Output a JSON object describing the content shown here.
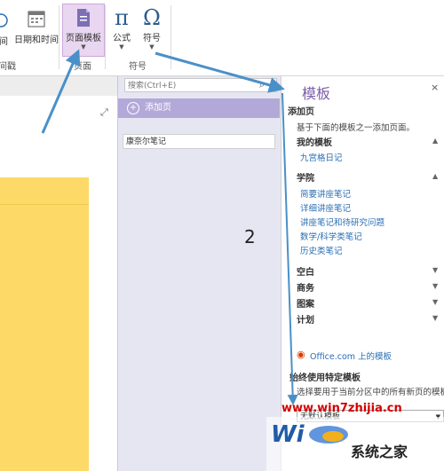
{
  "ribbon": {
    "left_button_label": "间",
    "datetime_label": "日期和时间",
    "page_template_label": "页面模板",
    "formula_label": "公式",
    "symbol_label": "符号",
    "group_timestamp": "间戳",
    "group_page": "页面",
    "group_symbols": "符号"
  },
  "search": {
    "placeholder": "搜索(Ctrl+E)"
  },
  "pages": {
    "add_label": "添加页",
    "items": [
      "康奈尔笔记"
    ]
  },
  "pane": {
    "title": "模板",
    "add_page_heading": "添加页",
    "add_page_desc": "基于下面的模板之一添加页面。",
    "my_templates": "我的模板",
    "my_items": [
      "九宫格日记"
    ],
    "academic": "学院",
    "academic_items": [
      "简要讲座笔记",
      "详细讲座笔记",
      "讲座笔记和待研究问题",
      "数学/科学类笔记",
      "历史类笔记"
    ],
    "categories": [
      "空白",
      "商务",
      "图案",
      "计划"
    ],
    "office_link": "Office.com 上的模板",
    "always_use_heading": "始终使用特定模板",
    "always_use_desc": "选择要用于当前分区中的所有新页的模板。",
    "default_select": "无默认模板"
  },
  "annotation": {
    "step_number": "2"
  },
  "watermark": {
    "url_text": "www.win7zhijia.cn",
    "brand": "系统之家"
  },
  "colors": {
    "accent_purple": "#b3a9d8",
    "sticky": "#fdd968",
    "arrow": "#4a90c8",
    "link": "#2a6fb4"
  }
}
